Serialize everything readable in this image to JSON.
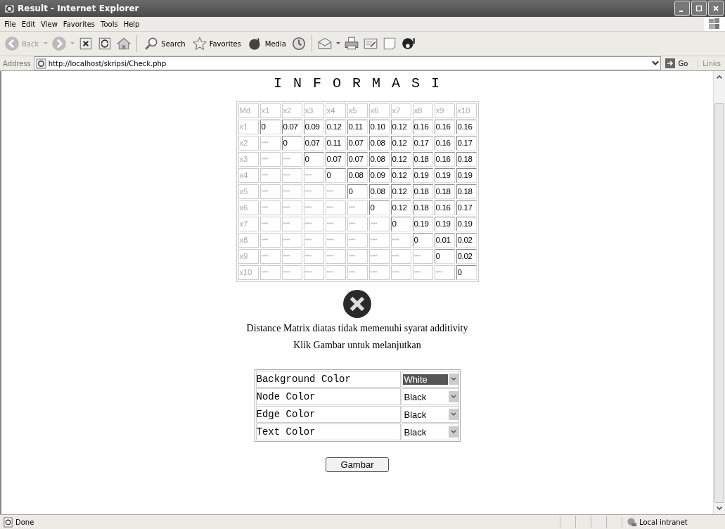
{
  "window": {
    "title": "Result - Internet Explorer"
  },
  "menu": [
    "File",
    "Edit",
    "View",
    "Favorites",
    "Tools",
    "Help"
  ],
  "toolbar": {
    "back": "Back",
    "search": "Search",
    "favorites": "Favorites",
    "media": "Media"
  },
  "address": {
    "label": "Address",
    "url": "http://localhost/skripsi/Check.php",
    "go": "Go",
    "links": "Links"
  },
  "page": {
    "heading": "I N F O R M A S I",
    "matrix": {
      "header": [
        "Md",
        "x1",
        "x2",
        "x3",
        "x4",
        "x5",
        "x6",
        "x7",
        "x8",
        "x9",
        "x10"
      ],
      "rows": [
        {
          "label": "x1",
          "cells": [
            {
              "value": "0",
              "disabled": false
            },
            {
              "value": "0.07",
              "disabled": false
            },
            {
              "value": "0.09",
              "disabled": false
            },
            {
              "value": "0.12",
              "disabled": false
            },
            {
              "value": "0.11",
              "disabled": false
            },
            {
              "value": "0.10",
              "disabled": false
            },
            {
              "value": "0.12",
              "disabled": false
            },
            {
              "value": "0.16",
              "disabled": false
            },
            {
              "value": "0.16",
              "disabled": false
            },
            {
              "value": "0.16",
              "disabled": false
            }
          ]
        },
        {
          "label": "x2",
          "cells": [
            {
              "value": "****",
              "disabled": true
            },
            {
              "value": "0",
              "disabled": false
            },
            {
              "value": "0.07",
              "disabled": false
            },
            {
              "value": "0.11",
              "disabled": false
            },
            {
              "value": "0.07",
              "disabled": false
            },
            {
              "value": "0.08",
              "disabled": false
            },
            {
              "value": "0.12",
              "disabled": false
            },
            {
              "value": "0.17",
              "disabled": false
            },
            {
              "value": "0.16",
              "disabled": false
            },
            {
              "value": "0.17",
              "disabled": false
            }
          ]
        },
        {
          "label": "x3",
          "cells": [
            {
              "value": "****",
              "disabled": true
            },
            {
              "value": "****",
              "disabled": true
            },
            {
              "value": "0",
              "disabled": false
            },
            {
              "value": "0.07",
              "disabled": false
            },
            {
              "value": "0.07",
              "disabled": false
            },
            {
              "value": "0.08",
              "disabled": false
            },
            {
              "value": "0.12",
              "disabled": false
            },
            {
              "value": "0.18",
              "disabled": false
            },
            {
              "value": "0.16",
              "disabled": false
            },
            {
              "value": "0.18",
              "disabled": false
            }
          ]
        },
        {
          "label": "x4",
          "cells": [
            {
              "value": "****",
              "disabled": true
            },
            {
              "value": "****",
              "disabled": true
            },
            {
              "value": "****",
              "disabled": true
            },
            {
              "value": "0",
              "disabled": false
            },
            {
              "value": "0.08",
              "disabled": false
            },
            {
              "value": "0.09",
              "disabled": false
            },
            {
              "value": "0.12",
              "disabled": false
            },
            {
              "value": "0.19",
              "disabled": false
            },
            {
              "value": "0.19",
              "disabled": false
            },
            {
              "value": "0.19",
              "disabled": false
            }
          ]
        },
        {
          "label": "x5",
          "cells": [
            {
              "value": "****",
              "disabled": true
            },
            {
              "value": "****",
              "disabled": true
            },
            {
              "value": "****",
              "disabled": true
            },
            {
              "value": "****",
              "disabled": true
            },
            {
              "value": "0",
              "disabled": false
            },
            {
              "value": "0.08",
              "disabled": false
            },
            {
              "value": "0.12",
              "disabled": false
            },
            {
              "value": "0.18",
              "disabled": false
            },
            {
              "value": "0.18",
              "disabled": false
            },
            {
              "value": "0.18",
              "disabled": false
            }
          ]
        },
        {
          "label": "x6",
          "cells": [
            {
              "value": "****",
              "disabled": true
            },
            {
              "value": "****",
              "disabled": true
            },
            {
              "value": "****",
              "disabled": true
            },
            {
              "value": "****",
              "disabled": true
            },
            {
              "value": "****",
              "disabled": true
            },
            {
              "value": "0",
              "disabled": false
            },
            {
              "value": "0.12",
              "disabled": false
            },
            {
              "value": "0.18",
              "disabled": false
            },
            {
              "value": "0.16",
              "disabled": false
            },
            {
              "value": "0.17",
              "disabled": false
            }
          ]
        },
        {
          "label": "x7",
          "cells": [
            {
              "value": "****",
              "disabled": true
            },
            {
              "value": "****",
              "disabled": true
            },
            {
              "value": "****",
              "disabled": true
            },
            {
              "value": "****",
              "disabled": true
            },
            {
              "value": "****",
              "disabled": true
            },
            {
              "value": "****",
              "disabled": true
            },
            {
              "value": "0",
              "disabled": false
            },
            {
              "value": "0.19",
              "disabled": false
            },
            {
              "value": "0.19",
              "disabled": false
            },
            {
              "value": "0.19",
              "disabled": false
            }
          ]
        },
        {
          "label": "x8",
          "cells": [
            {
              "value": "****",
              "disabled": true
            },
            {
              "value": "****",
              "disabled": true
            },
            {
              "value": "****",
              "disabled": true
            },
            {
              "value": "****",
              "disabled": true
            },
            {
              "value": "****",
              "disabled": true
            },
            {
              "value": "****",
              "disabled": true
            },
            {
              "value": "****",
              "disabled": true
            },
            {
              "value": "0",
              "disabled": false
            },
            {
              "value": "0.01",
              "disabled": false
            },
            {
              "value": "0.02",
              "disabled": false
            }
          ]
        },
        {
          "label": "x9",
          "cells": [
            {
              "value": "****",
              "disabled": true
            },
            {
              "value": "****",
              "disabled": true
            },
            {
              "value": "****",
              "disabled": true
            },
            {
              "value": "****",
              "disabled": true
            },
            {
              "value": "****",
              "disabled": true
            },
            {
              "value": "****",
              "disabled": true
            },
            {
              "value": "****",
              "disabled": true
            },
            {
              "value": "****",
              "disabled": true
            },
            {
              "value": "0",
              "disabled": false
            },
            {
              "value": "0.02",
              "disabled": false
            }
          ]
        },
        {
          "label": "x10",
          "cells": [
            {
              "value": "****",
              "disabled": true
            },
            {
              "value": "****",
              "disabled": true
            },
            {
              "value": "****",
              "disabled": true
            },
            {
              "value": "****",
              "disabled": true
            },
            {
              "value": "****",
              "disabled": true
            },
            {
              "value": "****",
              "disabled": true
            },
            {
              "value": "****",
              "disabled": true
            },
            {
              "value": "****",
              "disabled": true
            },
            {
              "value": "****",
              "disabled": true
            },
            {
              "value": "0",
              "disabled": false
            }
          ]
        }
      ]
    },
    "message": "Distance Matrix diatas tidak memenuhi syarat additivity",
    "hint": "Klik Gambar untuk melanjutkan",
    "settings": [
      {
        "label": "Background Color",
        "value": "White",
        "focused": true
      },
      {
        "label": "Node Color",
        "value": "Black",
        "focused": false
      },
      {
        "label": "Edge Color",
        "value": "Black",
        "focused": false
      },
      {
        "label": "Text Color",
        "value": "Black",
        "focused": false
      }
    ],
    "button": "Gambar"
  },
  "status_bar": {
    "text": "Done",
    "zone": "Local intranet"
  }
}
